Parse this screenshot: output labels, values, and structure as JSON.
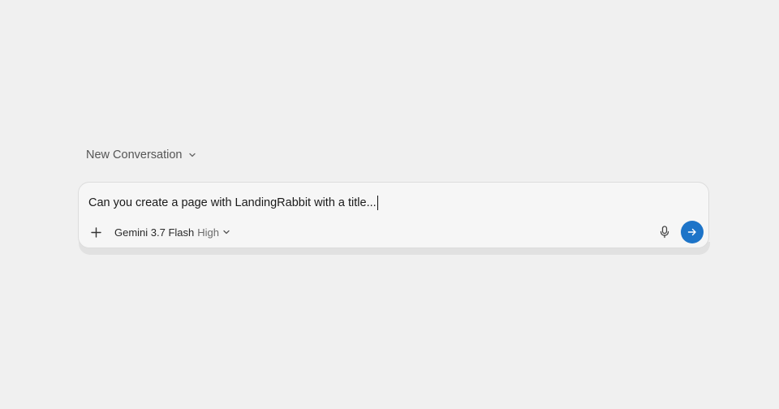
{
  "conversation": {
    "title": "New Conversation",
    "dropdown_icon": "chevron-down-icon"
  },
  "composer": {
    "input_value": "Can you create a page with LandingRabbit with a title..."
  },
  "toolbar": {
    "attach_icon": "plus-icon",
    "model_name": "Gemini 3.7 Flash",
    "model_level": "High",
    "mic_icon": "microphone-icon",
    "send_icon": "arrow-right-icon"
  },
  "colors": {
    "background": "#f0f0f0",
    "accent": "#1d74c8"
  }
}
